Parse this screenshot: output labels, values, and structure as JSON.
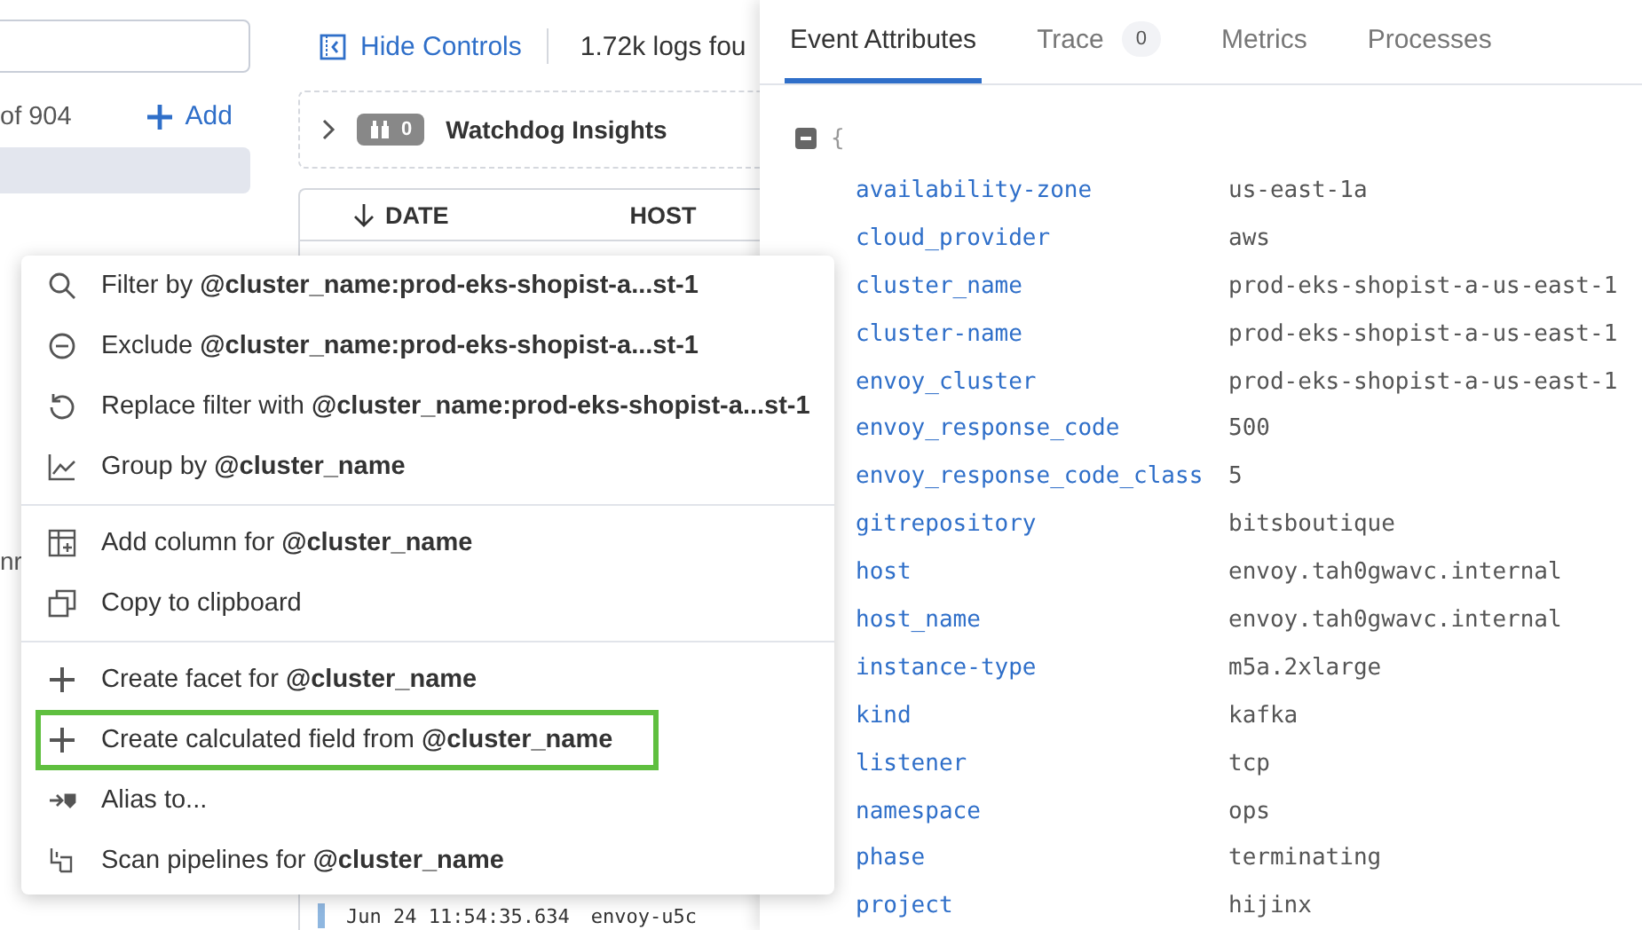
{
  "sidebar": {
    "count_text": "of 904",
    "add_button": "Add",
    "cut_text": "nr"
  },
  "toolbar": {
    "hide_controls": "Hide Controls",
    "logs_found": "1.72k logs fou"
  },
  "watchdog": {
    "count": "0",
    "label": "Watchdog Insights"
  },
  "table": {
    "columns": [
      "DATE",
      "HOST"
    ],
    "rows": [
      {
        "date": "Jun 24 11:54:35.634",
        "host": "envoy-u5c"
      }
    ]
  },
  "context_menu": {
    "sections": [
      [
        {
          "kind": "filter",
          "label": "Filter by **@cluster_name:prod-eks-shopist-a...st-1**",
          "highlighted": false
        },
        {
          "kind": "exclude",
          "label": "Exclude **@cluster_name:prod-eks-shopist-a...st-1**",
          "highlighted": false
        },
        {
          "kind": "replace",
          "label": "Replace filter with **@cluster_name:prod-eks-shopist-a...st-1**",
          "highlighted": false
        },
        {
          "kind": "group",
          "label": "Group by **@cluster_name**",
          "highlighted": false
        }
      ],
      [
        {
          "kind": "column",
          "label": "Add column for **@cluster_name**",
          "highlighted": false
        },
        {
          "kind": "copy",
          "label": "Copy to clipboard",
          "highlighted": false
        }
      ],
      [
        {
          "kind": "facet",
          "label": "Create facet for **@cluster_name**",
          "highlighted": false
        },
        {
          "kind": "calculated",
          "label": "Create calculated field from **@cluster_name**",
          "highlighted": true
        },
        {
          "kind": "alias",
          "label": "Alias to...",
          "highlighted": false
        },
        {
          "kind": "scan",
          "label": "Scan pipelines for **@cluster_name**",
          "highlighted": false
        }
      ]
    ]
  },
  "details": {
    "tabs": [
      {
        "label": "Event Attributes",
        "selected": true
      },
      {
        "label": "Trace",
        "badge": "0",
        "selected": false
      },
      {
        "label": "Metrics",
        "selected": false
      },
      {
        "label": "Processes",
        "selected": false
      }
    ],
    "open_brace": "{",
    "attributes": [
      {
        "key": "availability-zone",
        "value": "us-east-1a"
      },
      {
        "key": "cloud_provider",
        "value": "aws"
      },
      {
        "key": "cluster_name",
        "value": "prod-eks-shopist-a-us-east-1"
      },
      {
        "key": "cluster-name",
        "value": "prod-eks-shopist-a-us-east-1"
      },
      {
        "key": "envoy_cluster",
        "value": "prod-eks-shopist-a-us-east-1"
      },
      {
        "key": "envoy_response_code",
        "value": "500"
      },
      {
        "key": "envoy_response_code_class",
        "value": "5"
      },
      {
        "key": "gitrepository",
        "value": "bitsboutique"
      },
      {
        "key": "host",
        "value": "envoy.tah0gwavc.internal"
      },
      {
        "key": "host_name",
        "value": "envoy.tah0gwavc.internal"
      },
      {
        "key": "instance-type",
        "value": "m5a.2xlarge"
      },
      {
        "key": "kind",
        "value": "kafka"
      },
      {
        "key": "listener",
        "value": "tcp"
      },
      {
        "key": "namespace",
        "value": "ops"
      },
      {
        "key": "phase",
        "value": "terminating"
      },
      {
        "key": "project",
        "value": "hijinx"
      }
    ]
  }
}
